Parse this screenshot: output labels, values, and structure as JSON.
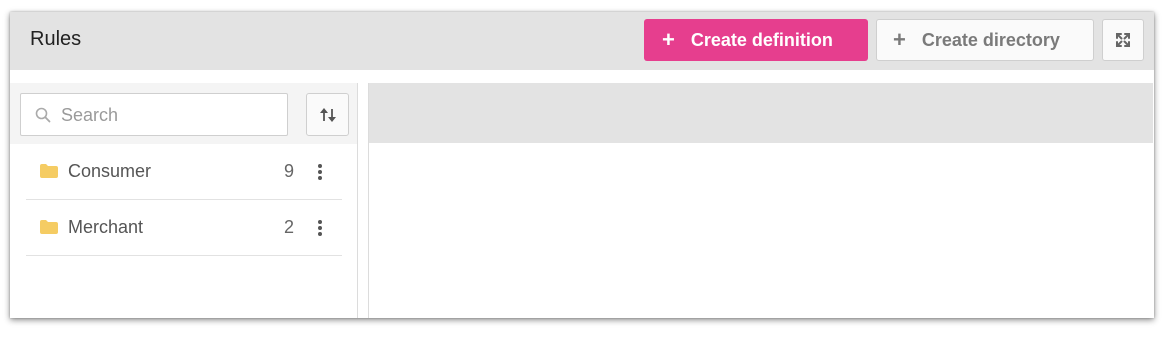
{
  "header": {
    "title": "Rules",
    "create_definition_label": "Create definition",
    "create_directory_label": "Create directory",
    "expand_icon": "expand-icon"
  },
  "sidebar": {
    "search": {
      "placeholder": "Search",
      "value": ""
    },
    "sort_icon": "sort-icon",
    "items": [
      {
        "label": "Consumer",
        "count": "9",
        "icon": "folder-icon"
      },
      {
        "label": "Merchant",
        "count": "2",
        "icon": "folder-icon"
      }
    ]
  },
  "colors": {
    "accent": "#e63e8e",
    "header_bg": "#e3e3e3",
    "folder": "#f5cc63"
  }
}
